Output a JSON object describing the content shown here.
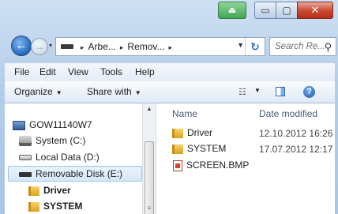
{
  "titlebar": {
    "minimize_glyph": "▭",
    "maximize_glyph": "▢",
    "close_glyph": "✕",
    "green_glyph": "⏏"
  },
  "nav": {
    "back_glyph": "←",
    "forward_glyph": "→",
    "recent_glyph": "▾",
    "breadcrumbs": [
      "Arbe...",
      "Remov..."
    ],
    "separator": "▸",
    "refresh_glyph": "↻",
    "search_placeholder": "Search Re...",
    "search_glyph": "⚲"
  },
  "menu": {
    "items": [
      "File",
      "Edit",
      "View",
      "Tools",
      "Help"
    ]
  },
  "commandbar": {
    "organize": "Organize",
    "share_with": "Share with",
    "dropdown_glyph": "▼",
    "views_glyph": "☷",
    "help_glyph": "?"
  },
  "navpane": {
    "computer": "GOW11140W7",
    "items": [
      {
        "label": "System (C:)",
        "icon": "system-drive-icon"
      },
      {
        "label": "Local Data (D:)",
        "icon": "drive-icon"
      },
      {
        "label": "Removable Disk (E:)",
        "icon": "removable-disk-icon"
      },
      {
        "label": "Driver",
        "icon": "folder-icon"
      },
      {
        "label": "SYSTEM",
        "icon": "folder-icon"
      }
    ],
    "scroll_up_glyph": "▲",
    "grip_glyph": "≡"
  },
  "filepane": {
    "columns": [
      "Name",
      "Date modified"
    ],
    "files": [
      {
        "name": "Driver",
        "date": "12.10.2012 16:26",
        "icon": "folder-icon"
      },
      {
        "name": "SYSTEM",
        "date": "17.07.2012 12:17",
        "icon": "folder-icon"
      },
      {
        "name": "SCREEN.BMP",
        "date": "",
        "icon": "bmp-file-icon"
      }
    ]
  }
}
